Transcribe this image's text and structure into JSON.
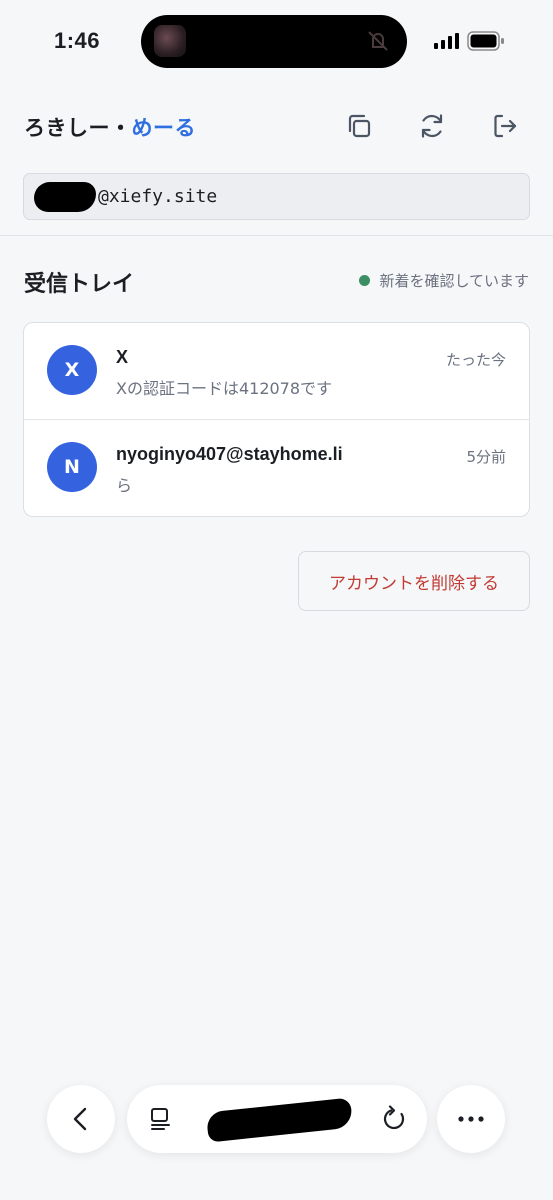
{
  "status_bar": {
    "time": "1:46"
  },
  "header": {
    "brand_main": "ろきしー・",
    "brand_accent": "めーる",
    "icons": [
      "copy-icon",
      "refresh-icon",
      "logout-icon"
    ]
  },
  "address": {
    "domain": "@xiefy.site"
  },
  "inbox": {
    "title": "受信トレイ",
    "status": "新着を確認しています",
    "messages": [
      {
        "avatar": "X",
        "sender": "X",
        "preview": "Xの認証コードは412078です",
        "time": "たった今"
      },
      {
        "avatar": "N",
        "sender": "nyoginyo407@stayhome.li",
        "preview": "ら",
        "time": "5分前"
      }
    ]
  },
  "actions": {
    "delete_account": "アカウントを削除する"
  },
  "colors": {
    "accent": "#2f6fe0",
    "avatar": "#3563e0",
    "danger": "#c23b33",
    "status_dot": "#3e8e65"
  }
}
